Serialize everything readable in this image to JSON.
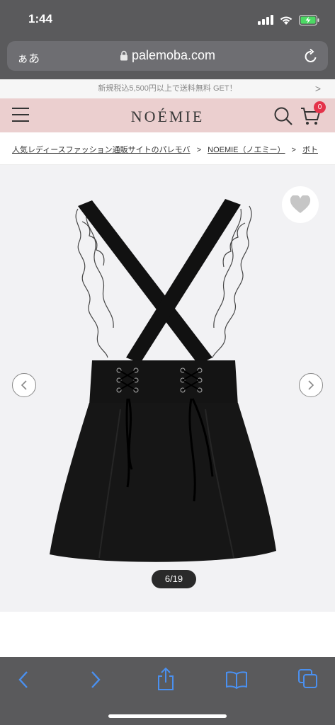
{
  "status_bar": {
    "time": "1:44"
  },
  "browser": {
    "text_size_label": "ぁあ",
    "url": "palemoba.com"
  },
  "site": {
    "promo_text": "新規税込5,500円以上で送料無料 GET！",
    "promo_arrow": ">",
    "logo": "NOÉMIE",
    "cart_count": "0"
  },
  "breadcrumb": [
    "人気レディースファッション通販サイトのパレモバ",
    "NOEMIE（ノエミー）",
    "ボト"
  ],
  "breadcrumb_separator": ">",
  "gallery": {
    "counter": "6/19"
  },
  "icons": [
    "signal-icon",
    "wifi-icon",
    "battery-icon",
    "lock-icon",
    "reload-icon",
    "hamburger-menu-icon",
    "search-icon",
    "cart-icon",
    "heart-icon",
    "chevron-left-icon",
    "chevron-right-icon",
    "share-icon",
    "bookmarks-icon",
    "tabs-icon"
  ],
  "colors": {
    "header_pink": "#ebcfcf",
    "badge_red": "#e4334a",
    "ios_blue": "#4a90f0",
    "chrome_gray": "#5a5a5c"
  }
}
